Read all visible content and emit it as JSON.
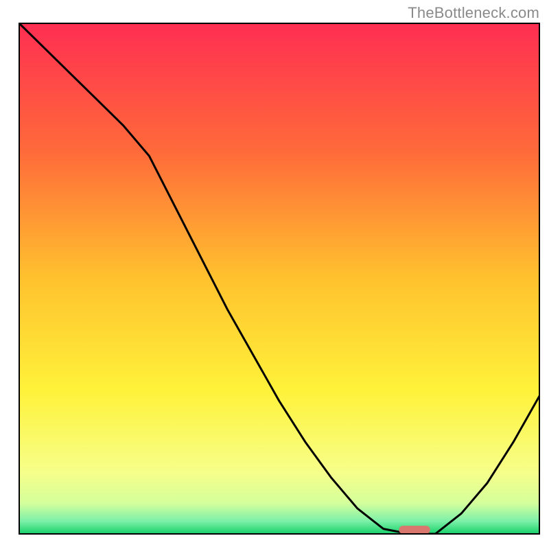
{
  "watermark": "TheBottleneck.com",
  "chart_data": {
    "type": "line",
    "title": "",
    "xlabel": "",
    "ylabel": "",
    "xlim": [
      0,
      100
    ],
    "ylim": [
      0,
      100
    ],
    "x": [
      0,
      5,
      10,
      15,
      20,
      25,
      30,
      35,
      40,
      45,
      50,
      55,
      60,
      65,
      70,
      75,
      80,
      85,
      90,
      95,
      100
    ],
    "values": [
      100,
      95,
      90,
      85,
      80,
      74,
      64,
      54,
      44,
      35,
      26,
      18,
      11,
      5,
      1,
      0,
      0,
      4,
      10,
      18,
      27
    ],
    "marker": {
      "x": 76,
      "y": 0,
      "color": "#d9766e",
      "width": 6,
      "height": 1.6
    },
    "gradient_stops": [
      {
        "offset": 0.0,
        "color": "#ff2e52"
      },
      {
        "offset": 0.25,
        "color": "#ff6a3a"
      },
      {
        "offset": 0.5,
        "color": "#ffc22e"
      },
      {
        "offset": 0.72,
        "color": "#fff23a"
      },
      {
        "offset": 0.88,
        "color": "#f6ff8a"
      },
      {
        "offset": 0.94,
        "color": "#d4ff9c"
      },
      {
        "offset": 0.975,
        "color": "#7cf0a8"
      },
      {
        "offset": 1.0,
        "color": "#18d06a"
      }
    ],
    "background_outside": "#ffffff",
    "frame_color": "#000000",
    "line_color": "#000000",
    "line_width": 3
  }
}
